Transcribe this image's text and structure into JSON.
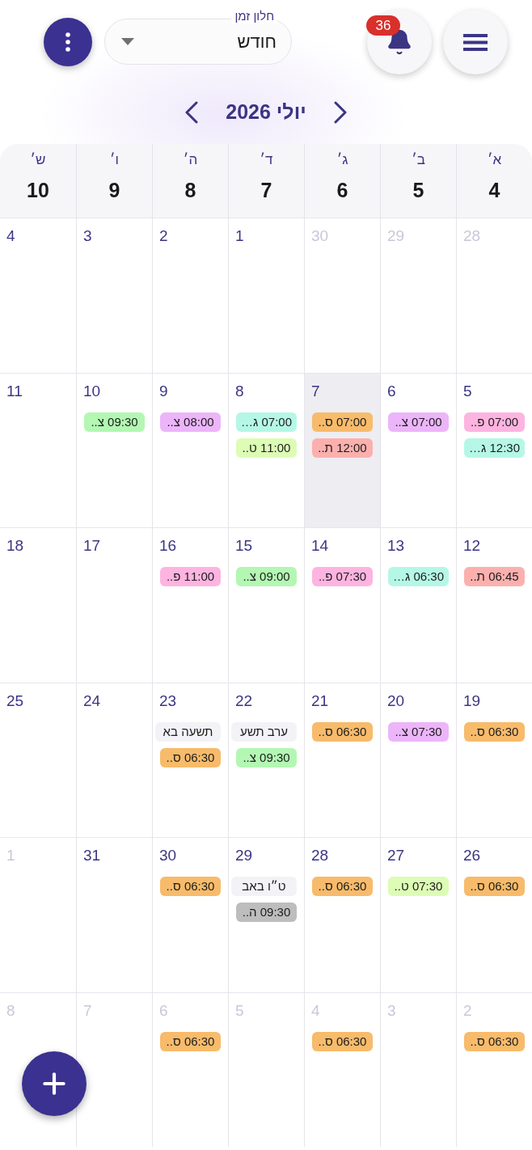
{
  "top_bar": {
    "notification_count": "36",
    "time_range": {
      "label": "חלון זמן",
      "value": "חודש"
    }
  },
  "month_nav": {
    "title": "יולי 2026"
  },
  "week_header": [
    {
      "day": "א׳",
      "date": "4"
    },
    {
      "day": "ב׳",
      "date": "5"
    },
    {
      "day": "ג׳",
      "date": "6"
    },
    {
      "day": "ד׳",
      "date": "7"
    },
    {
      "day": "ה׳",
      "date": "8"
    },
    {
      "day": "ו׳",
      "date": "9"
    },
    {
      "day": "ש׳",
      "date": "10"
    }
  ],
  "weeks": [
    {
      "days": [
        {
          "date": "28",
          "in_month": false,
          "today": false
        },
        {
          "date": "29",
          "in_month": false,
          "today": false
        },
        {
          "date": "30",
          "in_month": false,
          "today": false
        },
        {
          "date": "1",
          "in_month": true,
          "today": false
        },
        {
          "date": "2",
          "in_month": true,
          "today": false
        },
        {
          "date": "3",
          "in_month": true,
          "today": false
        },
        {
          "date": "4",
          "in_month": true,
          "today": false
        }
      ]
    },
    {
      "days": [
        {
          "date": "5",
          "in_month": true,
          "today": false,
          "items": [
            {
              "kind": "event",
              "text": "07:00 פ..",
              "color": "#fdb4e0"
            },
            {
              "kind": "event",
              "text": "12:30 ג…",
              "color": "#b5f7e6"
            }
          ]
        },
        {
          "date": "6",
          "in_month": true,
          "today": false,
          "items": [
            {
              "kind": "event",
              "text": "07:00 צ..",
              "color": "#ecb5f9"
            }
          ]
        },
        {
          "date": "7",
          "in_month": true,
          "today": true,
          "items": [
            {
              "kind": "event",
              "text": "07:00 ס..",
              "color": "#f7bb6b"
            },
            {
              "kind": "event",
              "text": "12:00 ת..",
              "color": "#fbb0ae"
            }
          ]
        },
        {
          "date": "8",
          "in_month": true,
          "today": false,
          "items": [
            {
              "kind": "event",
              "text": "07:00 ג…",
              "color": "#b5f7e6"
            },
            {
              "kind": "event",
              "text": "11:00 ט..",
              "color": "#ddfcb5"
            }
          ]
        },
        {
          "date": "9",
          "in_month": true,
          "today": false,
          "items": [
            {
              "kind": "event",
              "text": "08:00 צ..",
              "color": "#ecb5f9"
            }
          ]
        },
        {
          "date": "10",
          "in_month": true,
          "today": false,
          "items": [
            {
              "kind": "event",
              "text": "09:30 צ..",
              "color": "#b3f7b3"
            }
          ]
        },
        {
          "date": "11",
          "in_month": true,
          "today": false
        }
      ]
    },
    {
      "days": [
        {
          "date": "12",
          "in_month": true,
          "today": false,
          "items": [
            {
              "kind": "event",
              "text": "06:45 ת..",
              "color": "#fbb0ae"
            }
          ]
        },
        {
          "date": "13",
          "in_month": true,
          "today": false,
          "items": [
            {
              "kind": "event",
              "text": "06:30 ג…",
              "color": "#b5f7e6"
            }
          ]
        },
        {
          "date": "14",
          "in_month": true,
          "today": false,
          "items": [
            {
              "kind": "event",
              "text": "07:30 פ..",
              "color": "#fdb4e0"
            }
          ]
        },
        {
          "date": "15",
          "in_month": true,
          "today": false,
          "items": [
            {
              "kind": "event",
              "text": "09:00 צ..",
              "color": "#b3f7b3"
            }
          ]
        },
        {
          "date": "16",
          "in_month": true,
          "today": false,
          "items": [
            {
              "kind": "event",
              "text": "11:00 פ..",
              "color": "#fdb4e0"
            }
          ]
        },
        {
          "date": "17",
          "in_month": true,
          "today": false
        },
        {
          "date": "18",
          "in_month": true,
          "today": false
        }
      ]
    },
    {
      "days": [
        {
          "date": "19",
          "in_month": true,
          "today": false,
          "items": [
            {
              "kind": "event",
              "text": "06:30 ס..",
              "color": "#f7bb6b"
            }
          ]
        },
        {
          "date": "20",
          "in_month": true,
          "today": false,
          "items": [
            {
              "kind": "event",
              "text": "07:30 צ..",
              "color": "#ecb5f9"
            }
          ]
        },
        {
          "date": "21",
          "in_month": true,
          "today": false,
          "items": [
            {
              "kind": "event",
              "text": "06:30 ס..",
              "color": "#f7bb6b"
            }
          ]
        },
        {
          "date": "22",
          "in_month": true,
          "today": false,
          "items": [
            {
              "kind": "holiday",
              "text": "ערב תשע"
            },
            {
              "kind": "event",
              "text": "09:30 צ..",
              "color": "#b3f7b3"
            }
          ]
        },
        {
          "date": "23",
          "in_month": true,
          "today": false,
          "items": [
            {
              "kind": "holiday",
              "text": "תשעה בא"
            },
            {
              "kind": "event",
              "text": "06:30 ס..",
              "color": "#f7bb6b"
            }
          ]
        },
        {
          "date": "24",
          "in_month": true,
          "today": false
        },
        {
          "date": "25",
          "in_month": true,
          "today": false
        }
      ]
    },
    {
      "days": [
        {
          "date": "26",
          "in_month": true,
          "today": false,
          "items": [
            {
              "kind": "event",
              "text": "06:30 ס..",
              "color": "#f7bb6b"
            }
          ]
        },
        {
          "date": "27",
          "in_month": true,
          "today": false,
          "items": [
            {
              "kind": "event",
              "text": "07:30 ט..",
              "color": "#ddfcb5"
            }
          ]
        },
        {
          "date": "28",
          "in_month": true,
          "today": false,
          "items": [
            {
              "kind": "event",
              "text": "06:30 ס..",
              "color": "#f7bb6b"
            }
          ]
        },
        {
          "date": "29",
          "in_month": true,
          "today": false,
          "items": [
            {
              "kind": "holiday",
              "text": "ט״ו באב"
            },
            {
              "kind": "event",
              "text": "09:30 ה..",
              "color": "#bdbdbd"
            }
          ]
        },
        {
          "date": "30",
          "in_month": true,
          "today": false,
          "items": [
            {
              "kind": "event",
              "text": "06:30 ס..",
              "color": "#f7bb6b"
            }
          ]
        },
        {
          "date": "31",
          "in_month": true,
          "today": false
        },
        {
          "date": "1",
          "in_month": false,
          "today": false
        }
      ]
    },
    {
      "days": [
        {
          "date": "2",
          "in_month": false,
          "today": false,
          "items": [
            {
              "kind": "event",
              "text": "06:30 ס..",
              "color": "#f7bb6b"
            }
          ]
        },
        {
          "date": "3",
          "in_month": false,
          "today": false
        },
        {
          "date": "4",
          "in_month": false,
          "today": false,
          "items": [
            {
              "kind": "event",
              "text": "06:30 ס..",
              "color": "#f7bb6b"
            }
          ]
        },
        {
          "date": "5",
          "in_month": false,
          "today": false
        },
        {
          "date": "6",
          "in_month": false,
          "today": false,
          "items": [
            {
              "kind": "event",
              "text": "06:30 ס..",
              "color": "#f7bb6b"
            }
          ]
        },
        {
          "date": "7",
          "in_month": false,
          "today": false
        },
        {
          "date": "8",
          "in_month": false,
          "today": false
        }
      ]
    }
  ]
}
